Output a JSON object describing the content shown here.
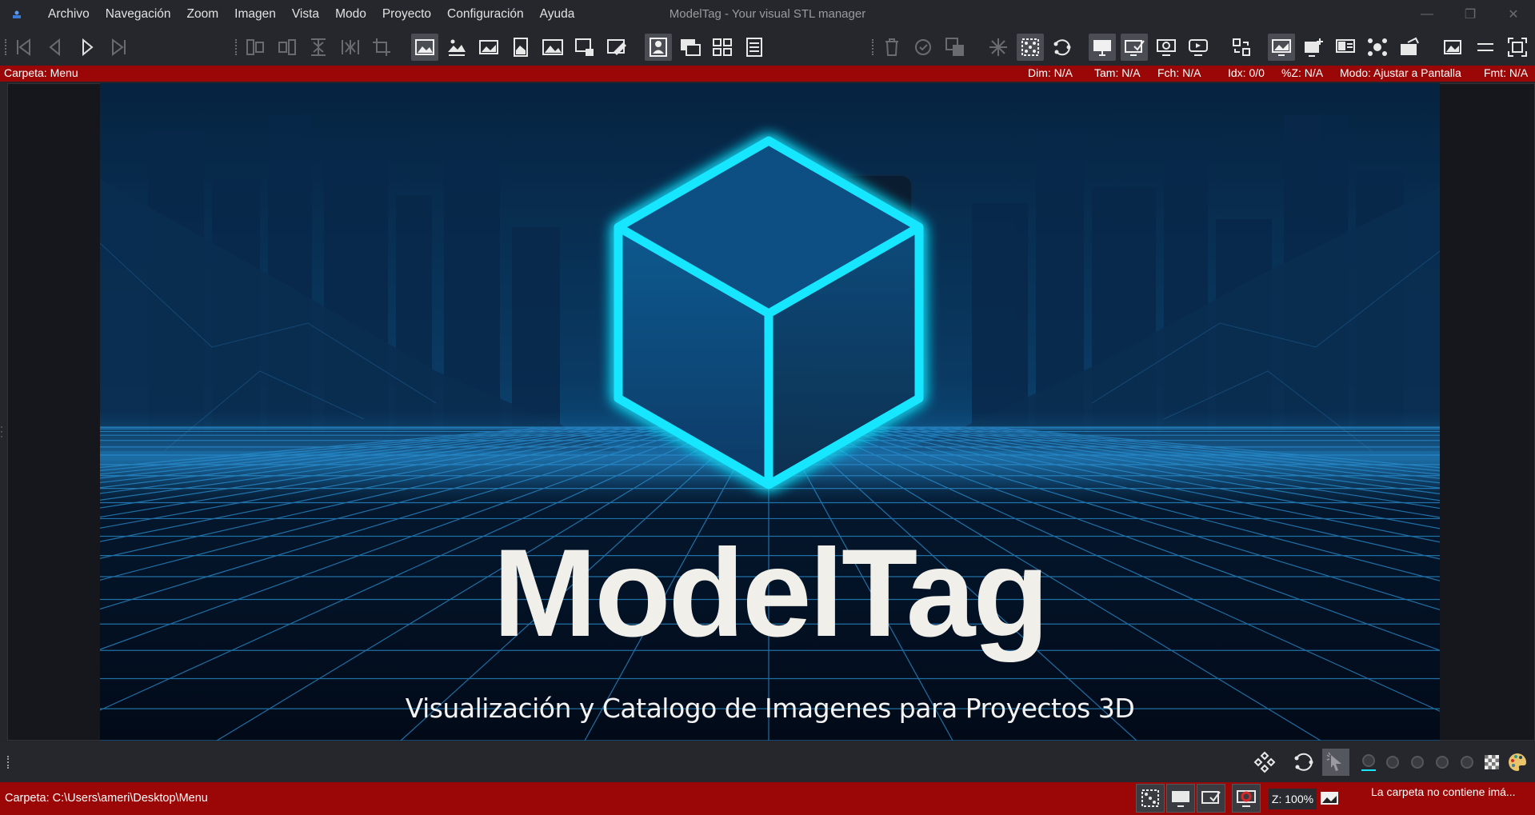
{
  "window": {
    "title": "ModelTag - Your visual STL manager",
    "controls": [
      "—",
      "❐",
      "✕"
    ]
  },
  "menu": [
    "Archivo",
    "Navegación",
    "Zoom",
    "Imagen",
    "Vista",
    "Modo",
    "Proyecto",
    "Configuración",
    "Ayuda"
  ],
  "info_bar": {
    "folder": "Carpeta: Menu",
    "dim": "Dim: N/A",
    "tam": "Tam: N/A",
    "fch": "Fch: N/A",
    "idx": "Idx: 0/0",
    "zoom_pct": "%Z: N/A",
    "mode": "Modo: Ajustar a Pantalla",
    "fmt": "Fmt: N/A"
  },
  "splash": {
    "brand": "ModelTag",
    "subtitle": "Visualización y Catalogo de Imagenes para Proyectos 3D",
    "colors": {
      "neon": "#19e6ff",
      "sky": "#06284a",
      "ground": "#041428"
    }
  },
  "status_bar": {
    "path": "Carpeta: C:\\Users\\ameri\\Desktop\\Menu",
    "zoom": "Z: 100%",
    "message": "La carpeta no contiene imá..."
  },
  "colors": {
    "accent_red": "#9b0606",
    "chrome": "#26272c",
    "selected": "#4b4d55"
  }
}
